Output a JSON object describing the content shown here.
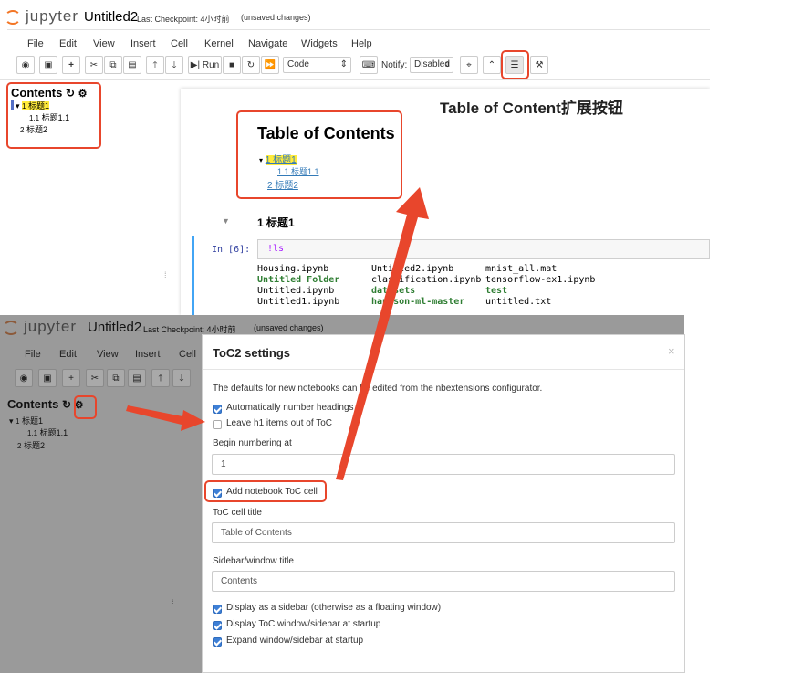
{
  "top": {
    "logo": "jupyter",
    "notebook_title": "Untitled2",
    "checkpoint": "Last Checkpoint: 4小时前",
    "unsaved": "(unsaved changes)",
    "menu": [
      "File",
      "Edit",
      "View",
      "Insert",
      "Cell",
      "Kernel",
      "Navigate",
      "Widgets",
      "Help"
    ],
    "toolbar": {
      "run_label": "Run",
      "cell_type": "Code",
      "notify_label": "Notify:",
      "notify_value": "Disabled"
    },
    "toc": {
      "heading": "Contents",
      "items": [
        {
          "num": "1",
          "text": "标题1"
        },
        {
          "num": "1.1",
          "text": "标题1.1"
        },
        {
          "num": "2",
          "text": "标题2"
        }
      ]
    },
    "annotation": "Table of Content扩展按钮",
    "toc_cell": {
      "heading": "Table of Contents",
      "items": [
        {
          "text": "1  标题1"
        },
        {
          "text": "1.1  标题1.1"
        },
        {
          "text": "2  标题2"
        }
      ]
    },
    "section_heading": "1  标题1",
    "prompt": "In [6]:",
    "command": "!ls",
    "output": [
      [
        "Housing.ipynb",
        "Untitled2.ipynb",
        "mnist_all.mat"
      ],
      [
        "Untitled Folder",
        "classification.ipynb",
        "tensorflow-ex1.ipynb"
      ],
      [
        "Untitled.ipynb",
        "datasets",
        "test"
      ],
      [
        "Untitled1.ipynb",
        "handson-ml-master",
        "untitled.txt"
      ]
    ]
  },
  "bottom": {
    "logo": "jupyter",
    "notebook_title": "Untitled2",
    "checkpoint": "Last Checkpoint: 4小时前",
    "unsaved": "(unsaved changes)",
    "menu": [
      "File",
      "Edit",
      "View",
      "Insert",
      "Cell"
    ],
    "toc": {
      "heading": "Contents",
      "items": [
        {
          "num": "1",
          "text": "标题1"
        },
        {
          "num": "1.1",
          "text": "标题1.1"
        },
        {
          "num": "2",
          "text": "标题2"
        }
      ]
    }
  },
  "modal": {
    "title": "ToC2 settings",
    "close": "×",
    "intro": "The defaults for new notebooks can be edited from the nbextensions configurator.",
    "auto_number": "Automatically number headings",
    "leave_h1": "Leave h1 items out of ToC",
    "begin_label": "Begin numbering at",
    "begin_value": "1",
    "add_toc_cell": "Add notebook ToC cell",
    "cell_title_label": "ToC cell title",
    "cell_title_value": "Table of Contents",
    "sidebar_title_label": "Sidebar/window title",
    "sidebar_title_value": "Contents",
    "opt_sidebar": "Display as a sidebar (otherwise as a floating window)",
    "opt_startup": "Display ToC window/sidebar at startup",
    "opt_expand": "Expand window/sidebar at startup"
  },
  "colors": {
    "accent_red": "#e8462c",
    "check_blue": "#3d7fd6",
    "highlight_yellow": "#ffeb3b",
    "link_blue": "#337ab7"
  }
}
